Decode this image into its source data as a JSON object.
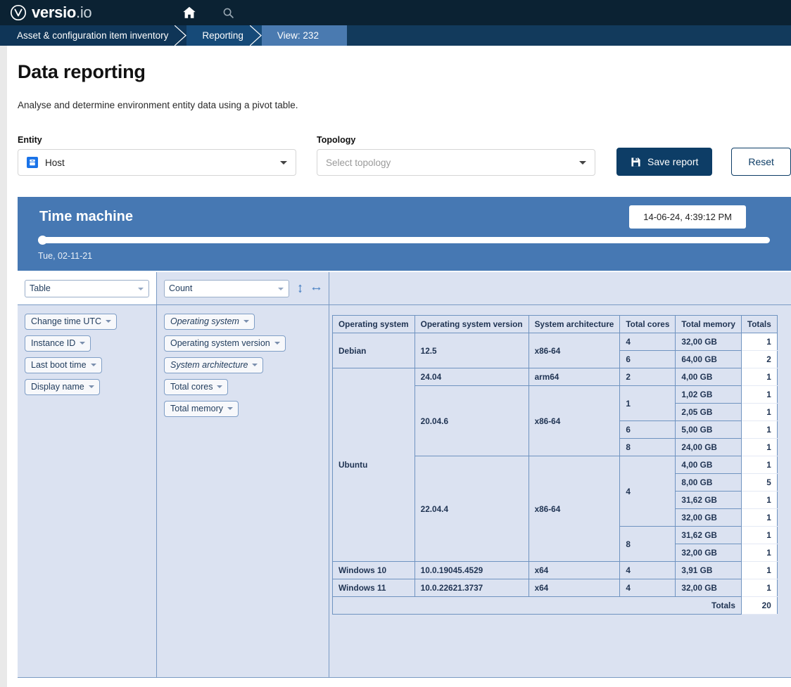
{
  "brand": {
    "name": "versio",
    "suffix": ".io",
    "logo_icon": "versio-circle-v-logo"
  },
  "topnav": {
    "home_icon": "home-icon",
    "search_icon": "search-icon"
  },
  "breadcrumb": {
    "items": [
      {
        "label": "Asset & configuration item inventory"
      },
      {
        "label": "Reporting"
      },
      {
        "label": "View: 232"
      }
    ]
  },
  "page": {
    "title": "Data reporting",
    "subtitle": "Analyse and determine environment entity data using a pivot table."
  },
  "filters": {
    "entity_label": "Entity",
    "entity_value": "Host",
    "entity_icon": "host-icon",
    "topology_label": "Topology",
    "topology_placeholder": "Select topology",
    "save_label": "Save report",
    "save_icon": "save-disk-icon",
    "reset_label": "Reset"
  },
  "time_machine": {
    "title": "Time machine",
    "datetime": "14-06-24, 4:39:12 PM",
    "date_label": "Tue, 02-11-21",
    "slider_position_percent": 0
  },
  "pivot": {
    "renderer": "Table",
    "aggregator": "Count",
    "icons": {
      "vertical": "arrows-vertical-icon",
      "horizontal": "arrows-horizontal-icon"
    },
    "unused_fields": [
      {
        "label": "Change time UTC",
        "italic": false
      },
      {
        "label": "Instance ID",
        "italic": false
      },
      {
        "label": "Last boot time",
        "italic": false
      },
      {
        "label": "Display name",
        "italic": false
      }
    ],
    "row_fields": [
      {
        "label": "Operating system",
        "italic": true
      },
      {
        "label": "Operating system version",
        "italic": false
      },
      {
        "label": "System architecture",
        "italic": true
      },
      {
        "label": "Total cores",
        "italic": false
      },
      {
        "label": "Total memory",
        "italic": false
      }
    ]
  },
  "chart_data": {
    "type": "table",
    "title": "Host pivot table — Count",
    "columns": [
      "Operating system",
      "Operating system version",
      "System architecture",
      "Total cores",
      "Total memory",
      "Totals"
    ],
    "rows": [
      {
        "os": "Debian",
        "os_version": "12.5",
        "arch": "x86-64",
        "cores": "4",
        "memory": "32,00 GB",
        "total": "1"
      },
      {
        "os": "Debian",
        "os_version": "12.5",
        "arch": "x86-64",
        "cores": "6",
        "memory": "64,00 GB",
        "total": "2"
      },
      {
        "os": "Ubuntu",
        "os_version": "24.04",
        "arch": "arm64",
        "cores": "2",
        "memory": "4,00 GB",
        "total": "1"
      },
      {
        "os": "Ubuntu",
        "os_version": "20.04.6",
        "arch": "x86-64",
        "cores": "1",
        "memory": "1,02 GB",
        "total": "1"
      },
      {
        "os": "Ubuntu",
        "os_version": "20.04.6",
        "arch": "x86-64",
        "cores": "1",
        "memory": "2,05 GB",
        "total": "1"
      },
      {
        "os": "Ubuntu",
        "os_version": "20.04.6",
        "arch": "x86-64",
        "cores": "6",
        "memory": "5,00 GB",
        "total": "1"
      },
      {
        "os": "Ubuntu",
        "os_version": "20.04.6",
        "arch": "x86-64",
        "cores": "8",
        "memory": "24,00 GB",
        "total": "1"
      },
      {
        "os": "Ubuntu",
        "os_version": "22.04.4",
        "arch": "x86-64",
        "cores": "4",
        "memory": "4,00 GB",
        "total": "1"
      },
      {
        "os": "Ubuntu",
        "os_version": "22.04.4",
        "arch": "x86-64",
        "cores": "4",
        "memory": "8,00 GB",
        "total": "5"
      },
      {
        "os": "Ubuntu",
        "os_version": "22.04.4",
        "arch": "x86-64",
        "cores": "4",
        "memory": "31,62 GB",
        "total": "1"
      },
      {
        "os": "Ubuntu",
        "os_version": "22.04.4",
        "arch": "x86-64",
        "cores": "4",
        "memory": "32,00 GB",
        "total": "1"
      },
      {
        "os": "Ubuntu",
        "os_version": "22.04.4",
        "arch": "x86-64",
        "cores": "8",
        "memory": "31,62 GB",
        "total": "1"
      },
      {
        "os": "Ubuntu",
        "os_version": "22.04.4",
        "arch": "x86-64",
        "cores": "8",
        "memory": "32,00 GB",
        "total": "1"
      },
      {
        "os": "Windows 10",
        "os_version": "10.0.19045.4529",
        "arch": "x64",
        "cores": "4",
        "memory": "3,91 GB",
        "total": "1"
      },
      {
        "os": "Windows 11",
        "os_version": "10.0.22621.3737",
        "arch": "x64",
        "cores": "4",
        "memory": "32,00 GB",
        "total": "1"
      }
    ],
    "totals_label": "Totals",
    "grand_total": "20"
  },
  "colors": {
    "topbar": "#0b2233",
    "breadcrumb_1": "#0f3557",
    "breadcrumb_2": "#164a78",
    "breadcrumb_3": "#4a7ab0",
    "primary_button": "#0d3d66",
    "time_machine": "#4678b3",
    "pivot_bg": "#dbe2f1",
    "table_border": "#6f93c0"
  }
}
